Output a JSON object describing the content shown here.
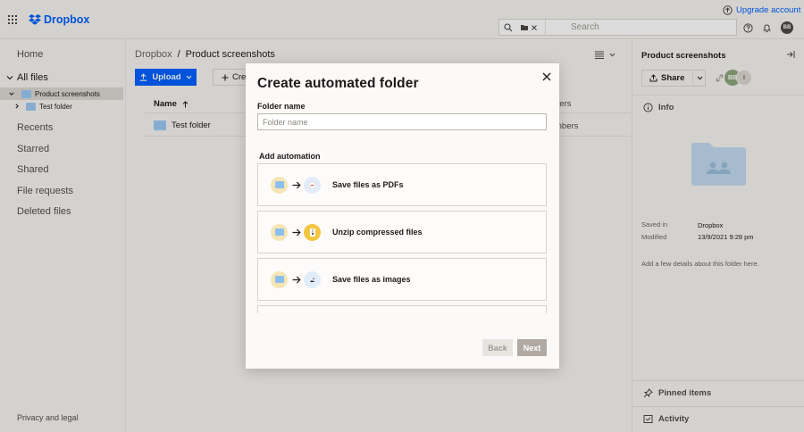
{
  "header": {
    "brand": "Dropbox",
    "upgrade_label": "Upgrade account",
    "search_placeholder": "Search",
    "user_initials": "BB"
  },
  "sidebar": {
    "home": "Home",
    "all_files": "All files",
    "tree": [
      {
        "label": "Product screenshots",
        "selected": true
      },
      {
        "label": "Test folder",
        "selected": false
      }
    ],
    "items": [
      "Recents",
      "Starred",
      "Shared",
      "File requests",
      "Deleted files"
    ],
    "privacy": "Privacy and legal"
  },
  "main": {
    "breadcrumb_root": "Dropbox",
    "breadcrumb_sep": "/",
    "breadcrumb_current": "Product screenshots",
    "upload_label": "Upload",
    "create_label": "Cre",
    "col_name": "Name",
    "col_members": "bers",
    "row_name": "Test folder",
    "row_members": "mbers"
  },
  "right_panel": {
    "title": "Product screenshots",
    "share_label": "Share",
    "avatar_initials": "BB",
    "avatar_second": "I",
    "info_label": "Info",
    "saved_in_label": "Saved in",
    "saved_in_value": "Dropbox",
    "modified_label": "Modified",
    "modified_value": "13/9/2021 9:28 pm",
    "hint": "Add a few details about this folder here.",
    "pinned_label": "Pinned items",
    "activity_label": "Activity"
  },
  "modal": {
    "title": "Create automated folder",
    "folder_name_label": "Folder name",
    "folder_name_placeholder": "Folder name",
    "add_automation_label": "Add automation",
    "options": [
      {
        "label": "Save files as PDFs",
        "icon": "pdf-icon",
        "badge_color": "#e3ecf9"
      },
      {
        "label": "Unzip compressed files",
        "icon": "zip-icon",
        "badge_color": "#f4c53f"
      },
      {
        "label": "Save files as images",
        "icon": "image-icon",
        "badge_color": "#e3ecf9"
      }
    ],
    "back_label": "Back",
    "next_label": "Next"
  },
  "colors": {
    "accent": "#0061fe",
    "folder": "#9ccaf4"
  }
}
